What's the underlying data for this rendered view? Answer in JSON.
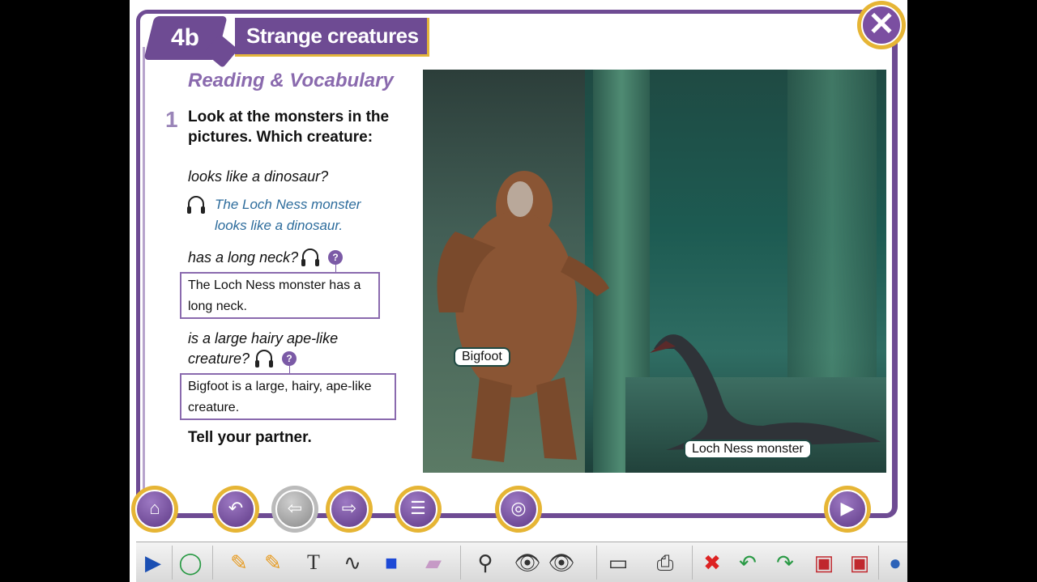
{
  "header": {
    "unit": "4b",
    "title": "Strange creatures"
  },
  "section": {
    "title": "Reading & Vocabulary"
  },
  "exercise": {
    "number": "1",
    "prompt": "Look at the monsters in the pictures. Which creature:",
    "items": [
      {
        "question": "looks like a dinosaur?",
        "example": "The Loch Ness monster looks like a dinosaur."
      },
      {
        "question": "has a long neck?",
        "answer": "The Loch Ness monster has a long neck."
      },
      {
        "question": "is a large hairy ape-like creature?",
        "answer": "Bigfoot is a large, hairy, ape-like creature."
      }
    ],
    "closing": "Tell your partner."
  },
  "picture": {
    "labels": [
      "Bigfoot",
      "Loch Ness monster"
    ]
  },
  "glyphs": {
    "close": "✕",
    "help": "?",
    "text_tool": "T"
  },
  "nav_buttons": [
    "home-icon",
    "back-icon",
    "previous-icon",
    "next-icon",
    "menu-icon",
    "audio-icon",
    "video-icon"
  ],
  "tools": [
    "expand-icon",
    "lasso-icon",
    "pencil-icon",
    "highlighter-icon",
    "text-icon",
    "curve-icon",
    "shape-icon",
    "eraser-icon",
    "zoom-icon",
    "reveal-icon",
    "hide-icon",
    "notes-icon",
    "print-icon",
    "clear-icon",
    "undo-icon",
    "redo-icon",
    "save-icon",
    "save-as-icon",
    "web-icon"
  ],
  "colors": {
    "brand_purple": "#6e4b93",
    "accent_gold": "#e6b535",
    "example_blue": "#2d6c9c"
  }
}
